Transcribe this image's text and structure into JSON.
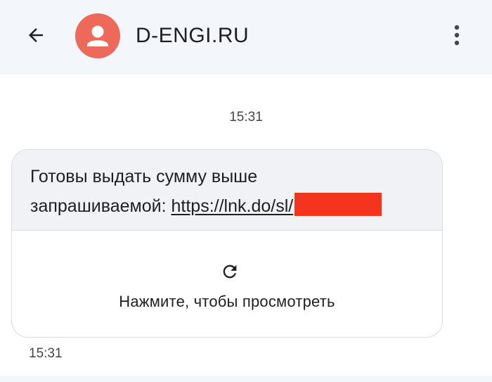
{
  "header": {
    "contact_name": "D-ENGI.RU",
    "back_icon": "arrow-back-icon",
    "avatar_icon": "person-icon",
    "menu_icon": "more-vert-icon",
    "avatar_color": "#ed6a5a",
    "background": "#f3f6fb"
  },
  "conversation": {
    "date_timestamp": "15:31",
    "message": {
      "line1": "Готовы выдать сумму выше",
      "line2_prefix": "запрашиваемой: ",
      "link": "https://lnk.do/sl/",
      "redaction_color": "#f5341f"
    },
    "preview": {
      "icon": "refresh-icon",
      "label": "Нажмите, чтобы просмотреть"
    },
    "message_timestamp": "15:31"
  }
}
